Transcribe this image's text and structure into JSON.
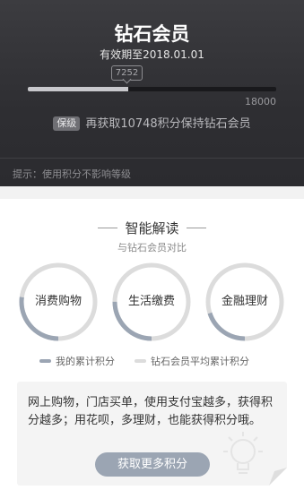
{
  "header": {
    "title": "钻石会员",
    "validity": "有效期至2018.01.01",
    "current_points": "7252",
    "progress": 0.403,
    "max_points": "18000",
    "keep_tag": "保级",
    "keep_text": "再获取10748积分保持钻石会员",
    "tip": "提示：使用积分不影响等级"
  },
  "analysis": {
    "title": "智能解读",
    "subtitle": "与钻石会员对比",
    "categories": [
      {
        "label": "消费购物",
        "my_ratio": 0.27
      },
      {
        "label": "生活缴费",
        "my_ratio": 0.25
      },
      {
        "label": "金融理财",
        "my_ratio": 0.2
      }
    ],
    "legend": {
      "mine": "我的累计积分",
      "average": "钻石会员平均累计积分"
    }
  },
  "info": {
    "text": "网上购物，门店买单，使用支付宝越多，获得积分越多；用花呗，多理财，也能获得积分哦。",
    "button_label": "获取更多积分"
  },
  "colors": {
    "header_bg": "#2e2e32",
    "mine": "#9ba5b3",
    "average": "#dcdcdc",
    "button": "#9ba5b3"
  }
}
